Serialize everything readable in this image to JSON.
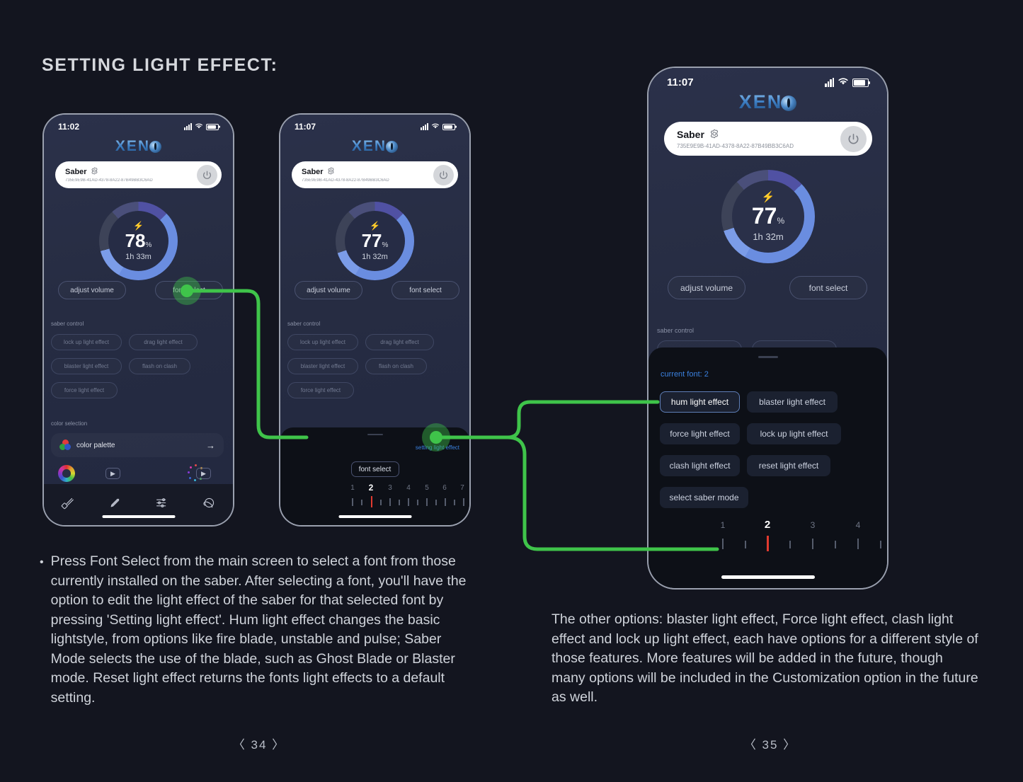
{
  "heading": "SETTING LIGHT EFFECT:",
  "phones": {
    "phone1": {
      "status": {
        "time": "11:02"
      },
      "logo": "XEN",
      "device": {
        "name": "Saber",
        "id": "735E9E9B-41AD-4378-8A22-87B49BB3C6AD"
      },
      "battery": {
        "percent": "78",
        "unit": "%",
        "eta": "1h 33m"
      },
      "actions": {
        "adjust_volume": "adjust volume",
        "font_select": "font select"
      },
      "saber_control_label": "saber control",
      "saber_control": [
        "lock up light effect",
        "drag light effect",
        "blaster light effect",
        "flash on clash",
        "force light effect"
      ],
      "color_selection_label": "color selection",
      "color_palette": "color palette"
    },
    "phone2": {
      "status": {
        "time": "11:07"
      },
      "logo": "XEN",
      "device": {
        "name": "Saber",
        "id": "735E9E9B-41AD-4378-8A22-87B49BB3C6AD"
      },
      "battery": {
        "percent": "77",
        "unit": "%",
        "eta": "1h 32m"
      },
      "actions": {
        "adjust_volume": "adjust volume",
        "font_select": "font select"
      },
      "saber_control_label": "saber control",
      "saber_control": [
        "lock up light effect",
        "drag light effect",
        "blaster light effect",
        "flash on clash",
        "force light effect"
      ],
      "sheet": {
        "setting_light_effect": "setting light effect",
        "font_select": "font select",
        "ruler": {
          "numbers": [
            "1",
            "2",
            "3",
            "4",
            "5",
            "6",
            "7"
          ],
          "active": "2"
        }
      }
    },
    "phone3": {
      "status": {
        "time": "11:07"
      },
      "logo": "XEN",
      "device": {
        "name": "Saber",
        "id": "735E9E9B-41AD-4378-8A22-87B49BB3C6AD"
      },
      "battery": {
        "percent": "77",
        "unit": "%",
        "eta": "1h 32m"
      },
      "actions": {
        "adjust_volume": "adjust volume",
        "font_select": "font select"
      },
      "saber_control_label": "saber control",
      "sheet": {
        "current_font": "current font: 2",
        "options": [
          "hum light effect",
          "blaster light effect",
          "force light effect",
          "lock up light effect",
          "clash light effect",
          "reset light effect",
          "select saber mode"
        ],
        "selected_option": "hum light effect",
        "ruler": {
          "numbers": [
            "1",
            "2",
            "3",
            "4"
          ],
          "active": "2"
        }
      }
    }
  },
  "body_left": "Press Font Select from the main screen to select a font from those currently installed on the saber. After selecting a font, you'll have the option to edit the light effect of the saber for that selected font by pressing 'Setting light effect'. Hum light effect changes the basic lightstyle, from options like fire blade, unstable and pulse; Saber Mode selects the use of the blade, such as Ghost Blade or Blaster mode. Reset light effect returns the fonts light effects to a default setting.",
  "body_right": "The other options: blaster light effect, Force light effect, clash light effect and lock up light effect, each have options for a different style of those features. More features will be added in the future, though many options will be included in the Customization option in the future as well.",
  "bullet_char": "•",
  "page_left": "〈 34 〉",
  "page_right": "〈 35 〉",
  "colors": {
    "background": "#13151f",
    "flow_green": "#3fc44a",
    "accent_blue": "#3b82e0",
    "ring_blue": "#6a8de0",
    "ruler_red": "#e03a2f"
  }
}
